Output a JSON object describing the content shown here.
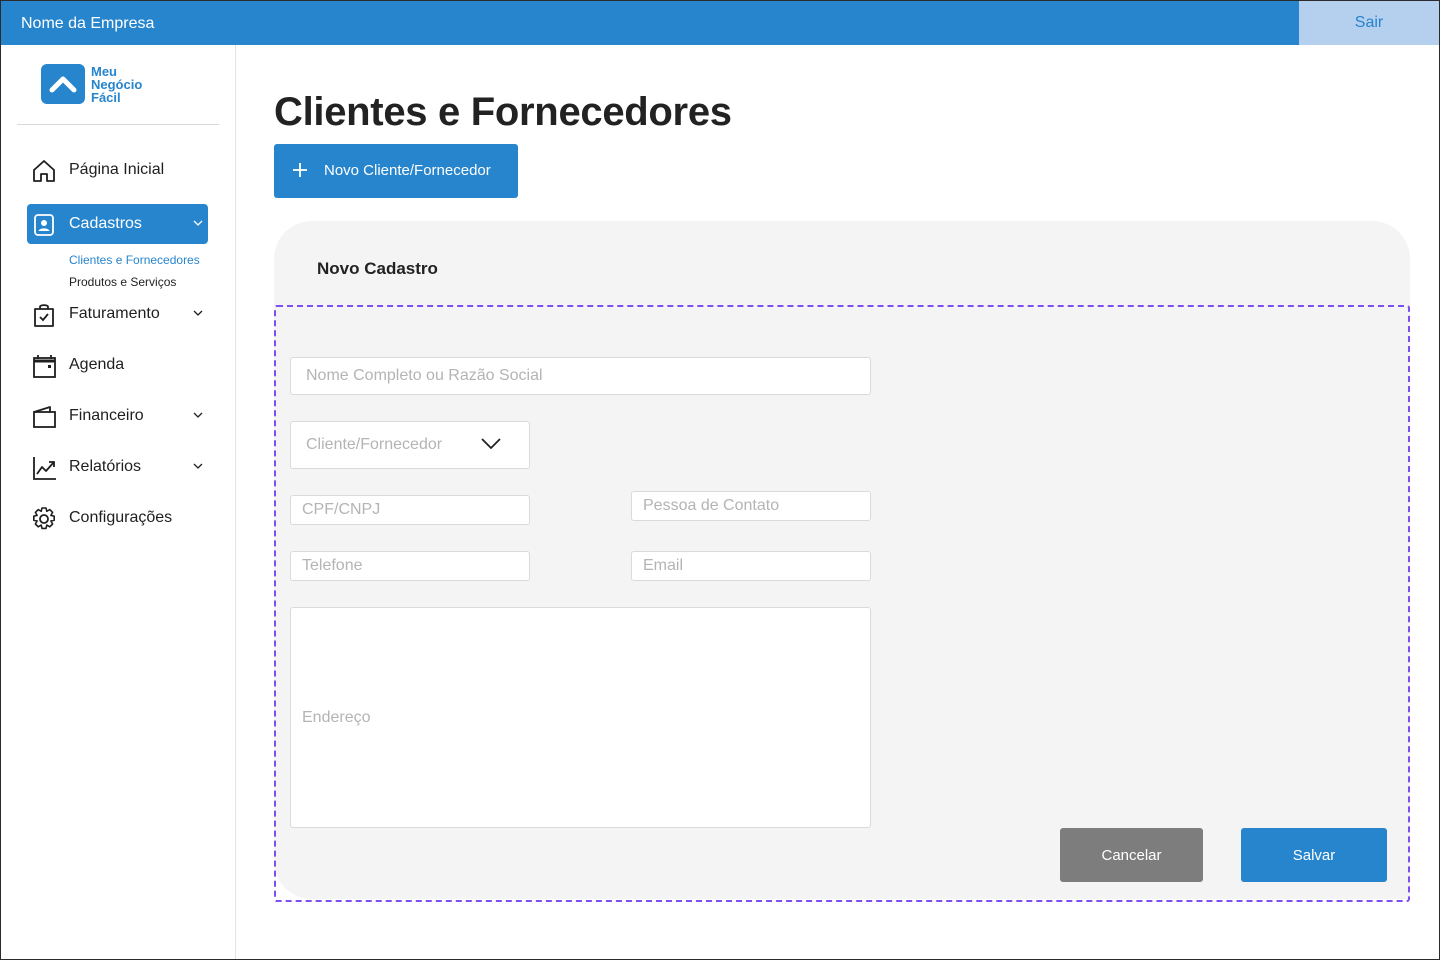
{
  "topbar": {
    "company_name": "Nome da Empresa",
    "logout_label": "Sair"
  },
  "logo": {
    "line1": "Meu",
    "line2": "Negócio",
    "line3": "Fácil"
  },
  "sidebar": {
    "items": [
      {
        "label": "Página Inicial",
        "icon": "home-icon"
      },
      {
        "label": "Cadastros",
        "icon": "contact-card-icon",
        "expanded": true
      },
      {
        "label": "Faturamento",
        "icon": "shopping-bag-check-icon"
      },
      {
        "label": "Agenda",
        "icon": "calendar-icon"
      },
      {
        "label": "Financeiro",
        "icon": "wallet-icon"
      },
      {
        "label": "Relatórios",
        "icon": "trend-chart-icon"
      },
      {
        "label": "Configurações",
        "icon": "gear-icon"
      }
    ],
    "subitems": [
      {
        "label": "Clientes e Fornecedores"
      },
      {
        "label": "Produtos e Serviços"
      }
    ]
  },
  "main": {
    "title": "Clientes e Fornecedores",
    "new_button_label": "Novo Cliente/Fornecedor"
  },
  "form": {
    "title": "Novo Cadastro",
    "name_placeholder": "Nome Completo ou Razão Social",
    "type_placeholder": "Cliente/Fornecedor",
    "document_placeholder": "CPF/CNPJ",
    "contact_placeholder": "Pessoa de Contato",
    "phone_placeholder": "Telefone",
    "email_placeholder": "Email",
    "address_placeholder": "Endereço",
    "cancel_label": "Cancelar",
    "save_label": "Salvar"
  },
  "colors": {
    "primary": "#2685cd",
    "logout_bg": "#b5cfee",
    "panel_bg": "#f4f4f4",
    "cancel_bg": "#7d7d7d",
    "dashed_border": "#7e4ff0"
  }
}
